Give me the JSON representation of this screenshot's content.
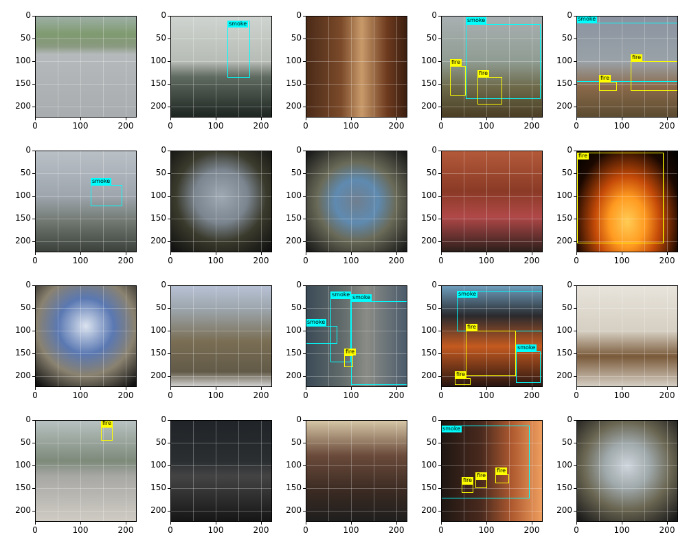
{
  "axis": {
    "xticks": [
      "0",
      "100",
      "200"
    ],
    "yticks": [
      "0",
      "50",
      "100",
      "150",
      "200"
    ],
    "max": 224
  },
  "colors": {
    "smoke": "#00ffff",
    "fire": "#ffff00"
  },
  "panels": [
    {
      "scene": "road",
      "boxes": []
    },
    {
      "scene": "smokestack",
      "boxes": [
        {
          "label": "smoke",
          "x": 125,
          "y": 10,
          "w": 50,
          "h": 125
        }
      ]
    },
    {
      "scene": "kitchen",
      "boxes": []
    },
    {
      "scene": "brushfire",
      "boxes": [
        {
          "label": "smoke",
          "x": 55,
          "y": 18,
          "w": 165,
          "h": 165
        },
        {
          "label": "fire",
          "x": 20,
          "y": 110,
          "w": 35,
          "h": 65
        },
        {
          "label": "fire",
          "x": 80,
          "y": 135,
          "w": 55,
          "h": 60
        }
      ]
    },
    {
      "scene": "fieldfire",
      "boxes": [
        {
          "label": "smoke",
          "x": 0,
          "y": 15,
          "w": 225,
          "h": 130
        },
        {
          "label": "fire",
          "x": 120,
          "y": 100,
          "w": 105,
          "h": 65
        },
        {
          "label": "fire",
          "x": 50,
          "y": 145,
          "w": 40,
          "h": 20
        }
      ]
    },
    {
      "scene": "tower",
      "boxes": [
        {
          "label": "smoke",
          "x": 122,
          "y": 75,
          "w": 70,
          "h": 47
        }
      ]
    },
    {
      "scene": "fisheye-dusk",
      "boxes": []
    },
    {
      "scene": "fisheye-mountains",
      "boxes": []
    },
    {
      "scene": "livingroom",
      "boxes": []
    },
    {
      "scene": "flames",
      "boxes": [
        {
          "label": "fire",
          "x": 2,
          "y": 5,
          "w": 190,
          "h": 200
        }
      ]
    },
    {
      "scene": "fisheye-sky",
      "boxes": []
    },
    {
      "scene": "hills-cam",
      "boxes": []
    },
    {
      "scene": "wildfire-smoke",
      "boxes": [
        {
          "label": "smoke",
          "x": 55,
          "y": 28,
          "w": 45,
          "h": 140
        },
        {
          "label": "smoke",
          "x": 100,
          "y": 35,
          "w": 125,
          "h": 185
        },
        {
          "label": "smoke",
          "x": 0,
          "y": 90,
          "w": 70,
          "h": 40
        },
        {
          "label": "fire",
          "x": 85,
          "y": 155,
          "w": 20,
          "h": 25
        }
      ]
    },
    {
      "scene": "forestfire",
      "boxes": [
        {
          "label": "smoke",
          "x": 35,
          "y": 12,
          "w": 190,
          "h": 90
        },
        {
          "label": "fire",
          "x": 55,
          "y": 100,
          "w": 110,
          "h": 100
        },
        {
          "label": "smoke",
          "x": 165,
          "y": 145,
          "w": 55,
          "h": 70
        },
        {
          "label": "fire",
          "x": 30,
          "y": 205,
          "w": 35,
          "h": 15
        }
      ]
    },
    {
      "scene": "classroom",
      "boxes": []
    },
    {
      "scene": "firetrucks",
      "boxes": [
        {
          "label": "fire",
          "x": 145,
          "y": 15,
          "w": 25,
          "h": 30
        }
      ]
    },
    {
      "scene": "night-city",
      "boxes": []
    },
    {
      "scene": "students",
      "boxes": []
    },
    {
      "scene": "sunset-fire",
      "boxes": [
        {
          "label": "smoke",
          "x": 0,
          "y": 12,
          "w": 195,
          "h": 160
        },
        {
          "label": "fire",
          "x": 45,
          "y": 140,
          "w": 25,
          "h": 20
        },
        {
          "label": "fire",
          "x": 75,
          "y": 130,
          "w": 25,
          "h": 20
        },
        {
          "label": "fire",
          "x": 120,
          "y": 120,
          "w": 30,
          "h": 20
        }
      ]
    },
    {
      "scene": "fisheye-valley",
      "boxes": []
    }
  ]
}
